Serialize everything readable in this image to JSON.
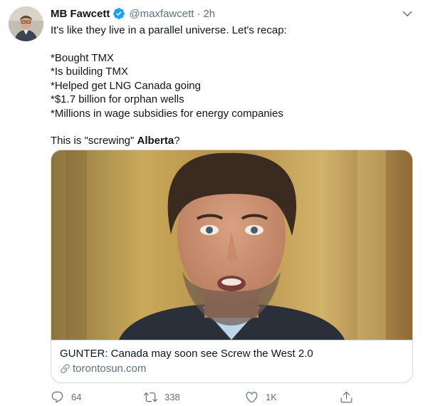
{
  "tweet": {
    "author": {
      "name": "MB Fawcett",
      "handle": "@maxfawcett",
      "verified": true
    },
    "separator": "·",
    "time": "2h",
    "lines": [
      "It's like they live in a parallel universe. Let's recap:",
      "*Bought TMX",
      "*Is building TMX",
      "*Helped get LNG Canada going",
      "*$1.7 billion for orphan wells",
      "*Millions in wage subsidies for energy companies"
    ],
    "closing": {
      "prefix": "This is \"screwing\" ",
      "bold": "Alberta",
      "suffix": "?"
    },
    "card": {
      "title": "GUNTER: Canada may soon see Screw the West 2.0",
      "domain": "torontosun.com"
    },
    "actions": {
      "reply_count": "64",
      "retweet_count": "338",
      "like_count": "1K"
    }
  },
  "icons": {
    "verified": "verified-badge-icon",
    "more": "chevron-down-icon",
    "link": "link-icon",
    "reply": "reply-icon",
    "retweet": "retweet-icon",
    "like": "heart-icon",
    "share": "share-icon"
  },
  "colors": {
    "accent": "#1da1f2",
    "secondary_text": "#5b7083",
    "border": "#cfd9de"
  }
}
